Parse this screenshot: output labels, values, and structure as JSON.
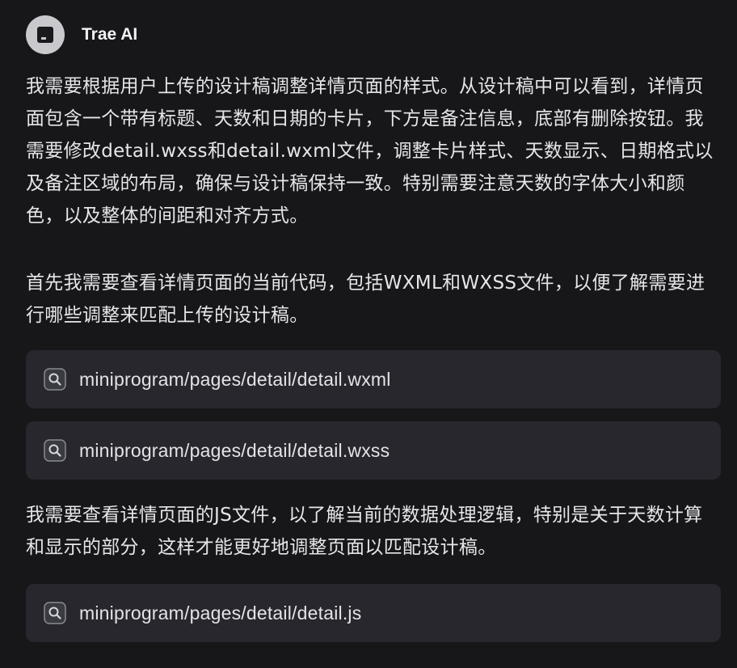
{
  "header": {
    "agent_name": "Trae AI",
    "avatar_icon": "trae-logo-icon"
  },
  "messages": [
    {
      "type": "text",
      "content": "我需要根据用户上传的设计稿调整详情页面的样式。从设计稿中可以看到，详情页面包含一个带有标题、天数和日期的卡片，下方是备注信息，底部有删除按钮。我需要修改detail.wxss和detail.wxml文件，调整卡片样式、天数显示、日期格式以及备注区域的布局，确保与设计稿保持一致。特别需要注意天数的字体大小和颜色，以及整体的间距和对齐方式。"
    },
    {
      "type": "text",
      "content": "首先我需要查看详情页面的当前代码，包括WXML和WXSS文件，以便了解需要进行哪些调整来匹配上传的设计稿。"
    },
    {
      "type": "file",
      "icon": "search-icon",
      "path": "miniprogram/pages/detail/detail.wxml"
    },
    {
      "type": "file",
      "icon": "search-icon",
      "path": "miniprogram/pages/detail/detail.wxss"
    },
    {
      "type": "text",
      "content": "我需要查看详情页面的JS文件，以了解当前的数据处理逻辑，特别是关于天数计算和显示的部分，这样才能更好地调整页面以匹配设计稿。"
    },
    {
      "type": "file",
      "icon": "search-icon",
      "path": "miniprogram/pages/detail/detail.js"
    }
  ],
  "colors": {
    "background": "#17171a",
    "card": "#27272d",
    "text": "#e6e6e9",
    "avatar": "#c9c9cd"
  }
}
